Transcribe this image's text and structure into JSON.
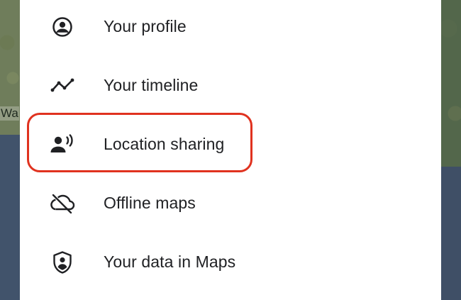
{
  "map": {
    "partial_label": "Wa"
  },
  "menu": {
    "items": [
      {
        "label": "Your profile",
        "icon": "account-circle-icon"
      },
      {
        "label": "Your timeline",
        "icon": "timeline-icon"
      },
      {
        "label": "Location sharing",
        "icon": "location-sharing-icon"
      },
      {
        "label": "Offline maps",
        "icon": "cloud-off-icon"
      },
      {
        "label": "Your data in Maps",
        "icon": "shield-person-icon"
      }
    ],
    "highlighted_item": "Location sharing"
  },
  "colors": {
    "highlight": "#e0321f",
    "icon": "#202124",
    "text": "#202124"
  }
}
